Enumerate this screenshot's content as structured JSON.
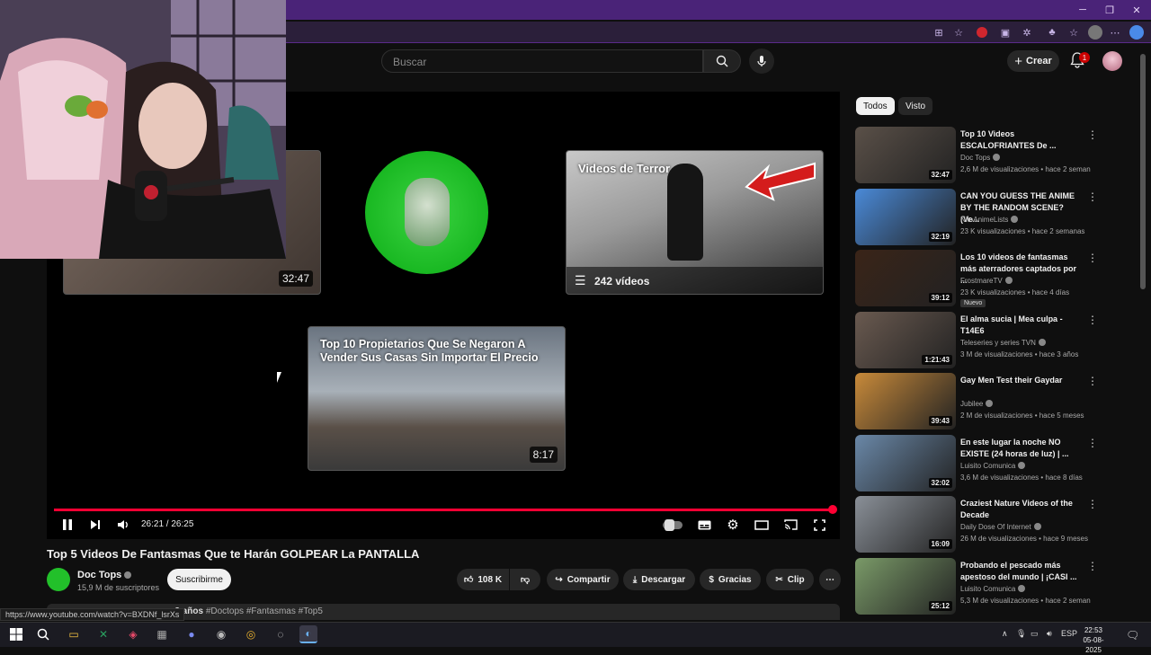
{
  "window": {
    "minimize_icon": "minimize-icon",
    "restore_icon": "restore-icon",
    "close_icon": "close-icon"
  },
  "header": {
    "search_placeholder": "Buscar",
    "create_label": "Crear",
    "notif_count": "1"
  },
  "player": {
    "endcards": [
      {
        "duration": "32:47"
      },
      {
        "title": "Videos de Terror",
        "count": "242 vídeos"
      },
      {
        "title": "Top 10 Propietarios Que Se Negaron A Vender Sus Casas Sin Importar El Precio",
        "duration": "8:17"
      }
    ],
    "time": "26:21 / 26:25",
    "progress": 0.997
  },
  "video": {
    "title": "Top 5 Videos De Fantasmas Que te Harán GOLPEAR La PANTALLA",
    "channel": "Doc Tops",
    "subscribers": "15,9 M de suscriptores",
    "subscribe_label": "Suscribirme",
    "likes": "108 K",
    "share_label": "Compartir",
    "download_label": "Descargar",
    "thanks_label": "Gracias",
    "clip_label": "Clip",
    "desc_date": "e 3 años",
    "desc_tags": "#Doctops #Fantasmas #Top5"
  },
  "status_url": "https://www.youtube.com/watch?v=BXDNf_lsrXs",
  "chips": [
    {
      "label": "Todos"
    },
    {
      "label": "Visto"
    }
  ],
  "recommendations": [
    {
      "title": "Top 10 Videos ESCALOFRIANTES De ...",
      "channel": "Doc Tops",
      "meta": "2,6 M de visualizaciones • hace 2 seman...",
      "duration": "32:47",
      "color": "#5a5048"
    },
    {
      "title": "CAN YOU GUESS THE ANIME BY THE RANDOM SCENE? (Ve...",
      "channel": "NitoAnimeLists",
      "meta": "23 K visualizaciones • hace 2 semanas",
      "duration": "32:19",
      "color": "#4a8ad8"
    },
    {
      "title": "Los 10 videos de fantasmas más aterradores captados por ...",
      "channel": "FrostmareTV",
      "meta": "23 K visualizaciones • hace 4 días",
      "duration": "39:12",
      "badge": "Nuevo",
      "color": "#3a2418"
    },
    {
      "title": "El alma sucia | Mea culpa - T14E6",
      "channel": "Teleseries y series TVN",
      "meta": "3 M de visualizaciones • hace 3 años",
      "duration": "1:21:43",
      "color": "#6a5a50"
    },
    {
      "title": "Gay Men Test their Gaydar",
      "channel": "Jubilee",
      "meta": "2 M de visualizaciones • hace 5 meses",
      "duration": "39:43",
      "color": "#c88a3a"
    },
    {
      "title": "En este lugar la noche NO EXISTE (24 horas de luz) | ...",
      "channel": "Luisito Comunica",
      "meta": "3,6 M de visualizaciones • hace 8 días",
      "duration": "32:02",
      "color": "#6a88a8"
    },
    {
      "title": "Craziest Nature Videos of the Decade",
      "channel": "Daily Dose Of Internet",
      "meta": "26 M de visualizaciones • hace 9 meses",
      "duration": "16:09",
      "color": "#8a9098"
    },
    {
      "title": "Probando el pescado más apestoso del mundo | ¡CASI ...",
      "channel": "Luisito Comunica",
      "meta": "5,3 M de visualizaciones • hace 2 seman...",
      "duration": "25:12",
      "color": "#7a9a68"
    }
  ],
  "taskbar": {
    "lang": "ESP",
    "time": "22:53",
    "date": "05-08-2025"
  }
}
